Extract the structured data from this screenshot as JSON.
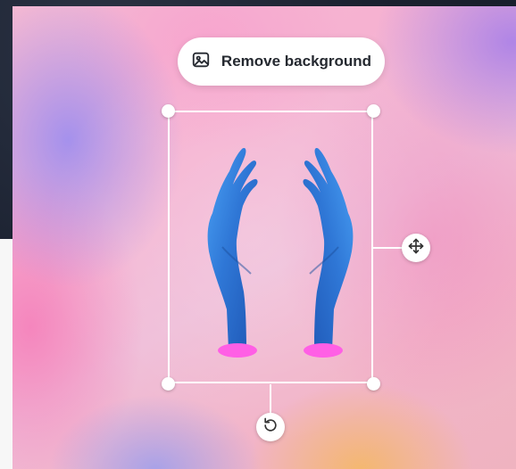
{
  "toolbar": {
    "remove_background_label": "Remove background",
    "remove_background_icon": "image-icon"
  },
  "selection": {
    "move_icon": "move-icon",
    "rotate_icon": "rotate-icon"
  },
  "colors": {
    "accent_white": "#ffffff",
    "hands_blue": "#2f77d6",
    "hands_pink_base": "#ff5fe5",
    "label_text": "#252930"
  }
}
